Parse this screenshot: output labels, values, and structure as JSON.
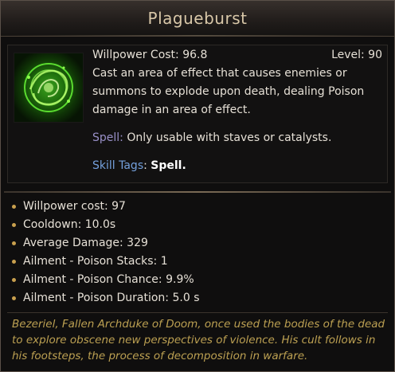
{
  "skill": {
    "name": "Plagueburst",
    "willpower_cost_label": "Willpower Cost: 96.8",
    "level_label": "Level: 90",
    "description": "Cast an area of effect that causes enemies or summons to explode upon death, dealing Poison damage in an area of effect.",
    "spell_label": "Spell:",
    "spell_text": " Only usable with staves or catalysts.",
    "tags_label": "Skill Tags",
    "tags_colon": ": ",
    "tags_value": "Spell.",
    "icon": "poison-swirl-icon"
  },
  "stats": [
    "Willpower cost: 97",
    "Cooldown: 10.0s",
    "Average Damage: 329",
    "Ailment - Poison Stacks: 1",
    "Ailment - Poison Chance: 9.9%",
    "Ailment - Poison Duration: 5.0 s"
  ],
  "lore": "Bezeriel, Fallen Archduke of Doom, once used the bodies of the dead to explore obscene new perspectives of violence. His cult follows in his footsteps, the process of decomposition in warfare.",
  "colors": {
    "title": "#d8c7a8",
    "spell_label": "#9990c8",
    "tags_label": "#74a0dc",
    "lore": "#bca052",
    "bullet": "#c9a04e"
  }
}
